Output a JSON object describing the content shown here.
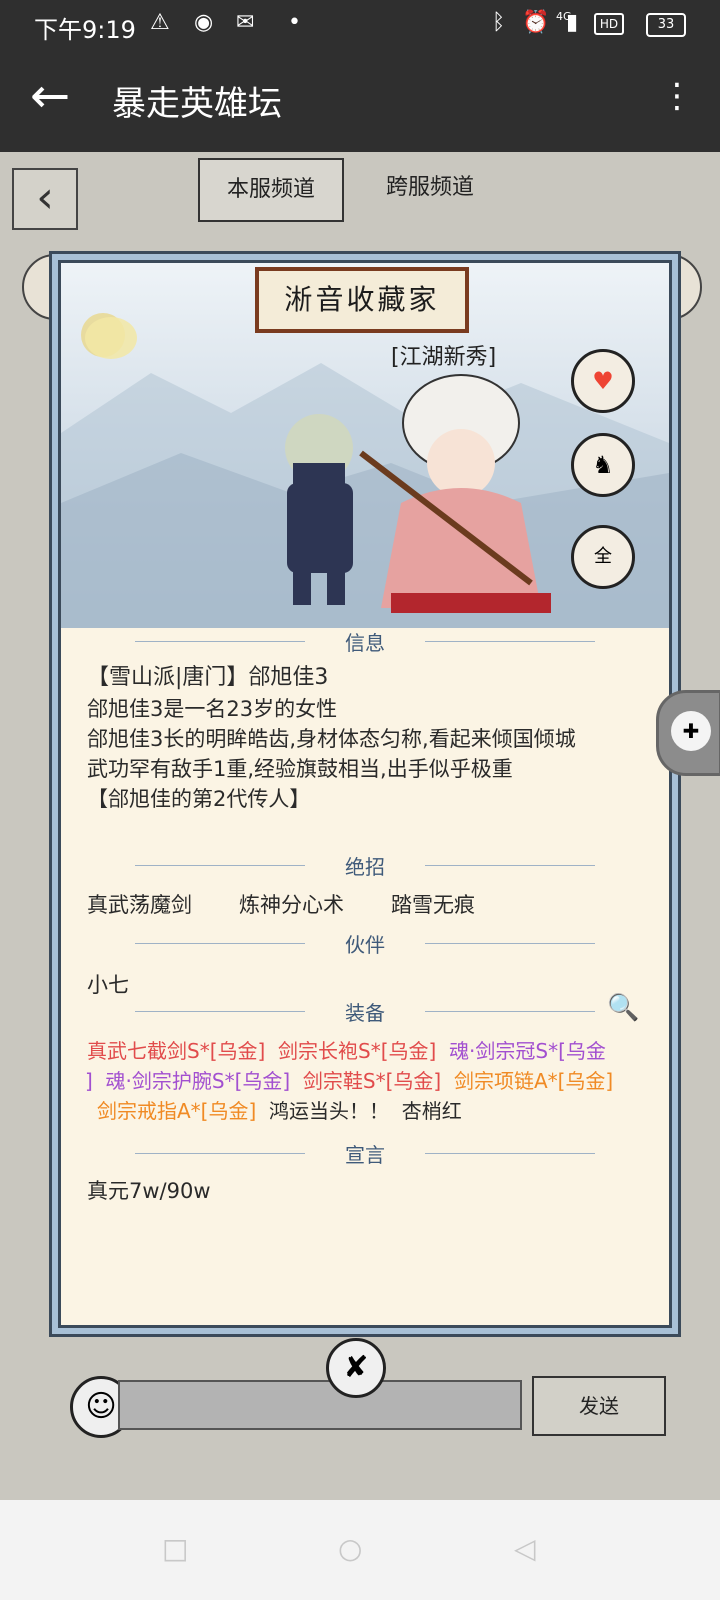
{
  "status": {
    "time": "下午9:19",
    "icons": [
      "warning-icon",
      "qq-icon",
      "wechat-icon",
      "dot-icon",
      "bluetooth-icon",
      "alarm-icon",
      "signal-icon",
      "hd-icon"
    ],
    "network": "4G",
    "hd": "HD",
    "battery": "33"
  },
  "appbar": {
    "title": "暴走英雄坛"
  },
  "tabs": [
    {
      "label": "本服频道"
    },
    {
      "label": "跨服频道"
    }
  ],
  "card": {
    "banner": "淅音收藏家",
    "rank": "[江湖新秀]",
    "sections": {
      "info": "信息",
      "skills": "绝招",
      "partner": "伙伴",
      "equip": "装备",
      "declaration": "宣言"
    },
    "info_lines": [
      "【雪山派|唐门】郃旭佳3",
      "郃旭佳3是一名23岁的女性",
      "郃旭佳3长的明眸皓齿,身材体态匀称,看起来倾国倾城",
      "武功罕有敌手1重,经验旗鼓相当,出手似乎极重",
      "【郃旭佳的第2代传人】"
    ],
    "skills": [
      "真武荡魔剑",
      "炼神分心术",
      "踏雪无痕"
    ],
    "partner": "小七",
    "equipment": [
      {
        "name": "真武七截剑S*[乌金]",
        "color": "#e14b4b"
      },
      {
        "name": "剑宗长袍S*[乌金]",
        "color": "#e14b4b"
      },
      {
        "name": "魂·剑宗冠S*[乌金",
        "color": "#a24fd0"
      },
      {
        "name": "]",
        "color": "#a24fd0"
      },
      {
        "name": "魂·剑宗护腕S*[乌金]",
        "color": "#a24fd0"
      },
      {
        "name": "剑宗鞋S*[乌金]",
        "color": "#e14b4b"
      },
      {
        "name": "剑宗项链A*[乌金]",
        "color": "#f08a24"
      },
      {
        "name": "剑宗戒指A*[乌金]",
        "color": "#f08a24"
      },
      {
        "name": "鸿运当头！！",
        "color": "#2a2a2a"
      },
      {
        "name": "杏梢红",
        "color": "#2a2a2a"
      }
    ],
    "declaration": "真元7w/90w"
  },
  "buttons": {
    "send": "发送"
  },
  "colors": {
    "bar": "#2f2f2f",
    "card_bg": "#fbf4e4",
    "section": "#3f5a7a"
  }
}
